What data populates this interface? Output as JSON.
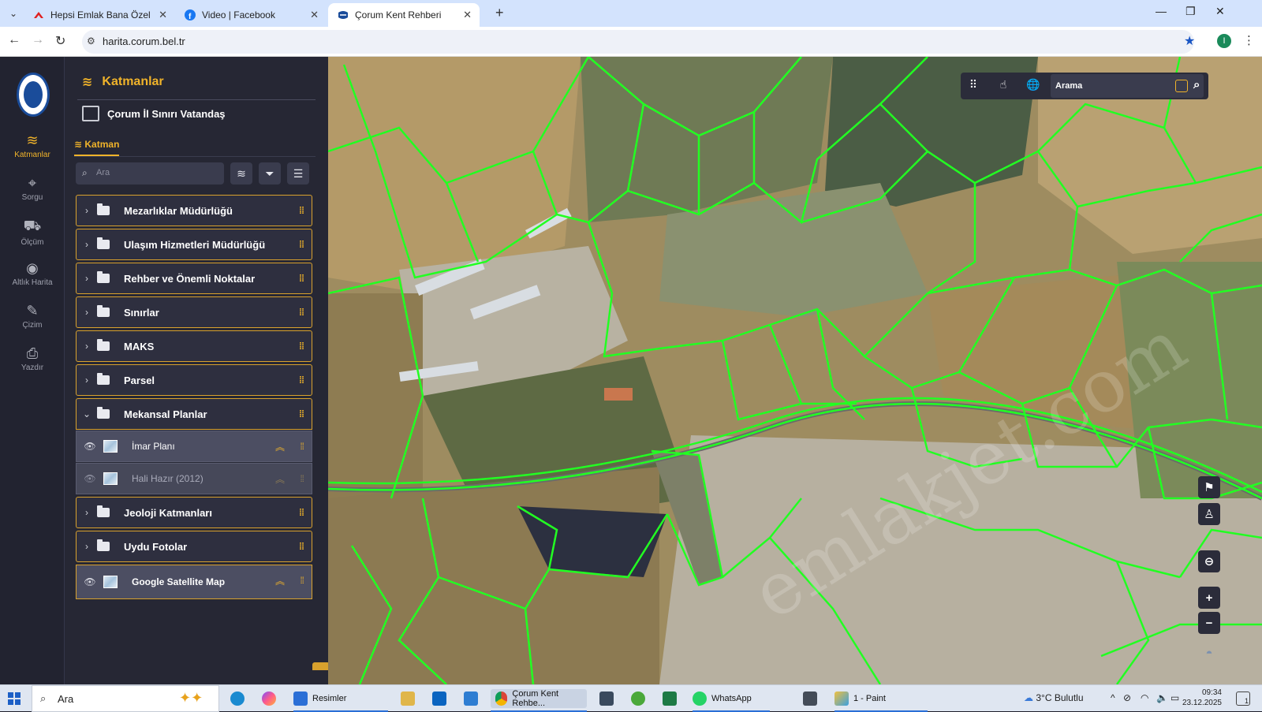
{
  "browser": {
    "tabs": [
      {
        "title": "Hepsi Emlak Bana Özel",
        "icon": "hepsiemlak-icon",
        "active": false
      },
      {
        "title": "Video | Facebook",
        "icon": "facebook-icon",
        "active": false
      },
      {
        "title": "Çorum Kent Rehberi",
        "icon": "site-icon",
        "active": true
      }
    ],
    "url": "harita.corum.bel.tr"
  },
  "rail": {
    "items": [
      {
        "label": "Katmanlar",
        "icon": "layers-icon",
        "active": true
      },
      {
        "label": "Sorgu",
        "icon": "location-pin-icon",
        "active": false
      },
      {
        "label": "Ölçüm",
        "icon": "measure-icon",
        "active": false
      },
      {
        "label": "Altlık Harita",
        "icon": "basemap-icon",
        "active": false
      },
      {
        "label": "Çizim",
        "icon": "pencil-icon",
        "active": false
      },
      {
        "label": "Yazdır",
        "icon": "printer-icon",
        "active": false
      }
    ]
  },
  "panel": {
    "title": "Katmanlar",
    "basemap_label": "Çorum İl Sınırı Vatandaş",
    "subtab": "Katman",
    "search_placeholder": "Ara",
    "groups": [
      {
        "label": "Mezarlıklar Müdürlüğü",
        "open": false
      },
      {
        "label": "Ulaşım Hizmetleri Müdürlüğü",
        "open": false
      },
      {
        "label": "Rehber ve Önemli Noktalar",
        "open": false
      },
      {
        "label": "Sınırlar",
        "open": false
      },
      {
        "label": "MAKS",
        "open": false
      },
      {
        "label": "Parsel",
        "open": false
      },
      {
        "label": "Mekansal Planlar",
        "open": true
      },
      {
        "label": "Jeoloji Katmanları",
        "open": false
      },
      {
        "label": "Uydu Fotolar",
        "open": false
      }
    ],
    "sublayers": [
      {
        "label": "İmar Planı",
        "visible": true
      },
      {
        "label": "Hali Hazır (2012)",
        "visible": false
      }
    ],
    "satellite_layer": {
      "label": "Google Satellite Map",
      "visible": true
    }
  },
  "map": {
    "search_label": "Arama",
    "watermark": "emlakjet.com",
    "parcel_color": "#22ff22",
    "accent": "#f0b32a"
  },
  "taskbar": {
    "search_label": "Ara",
    "apps": [
      {
        "label": "Resimler"
      },
      {
        "label": "Çorum Kent Rehbe..."
      },
      {
        "label": "WhatsApp"
      },
      {
        "label": "1 - Paint"
      }
    ],
    "weather": "3°C  Bulutlu",
    "time": "09:34",
    "date": "23.12.2025",
    "notifications": "1"
  }
}
